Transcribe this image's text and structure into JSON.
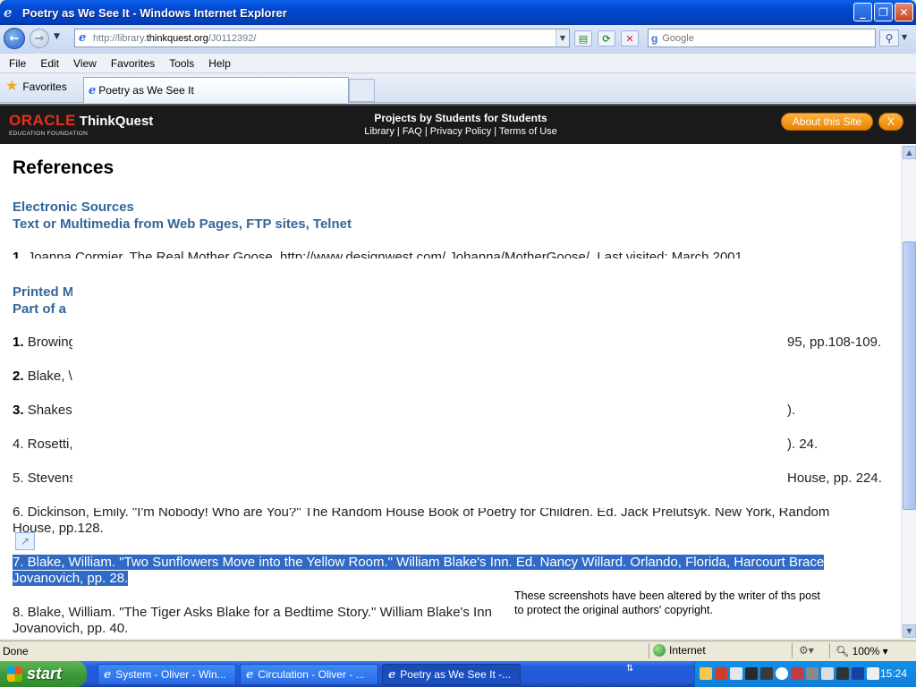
{
  "window": {
    "title": "Poetry as We See It - Windows Internet Explorer",
    "min_label": "_",
    "max_label": "❐",
    "close_label": "✕"
  },
  "address": {
    "url_prefix": "http://library.",
    "url_domain": "thinkquest.org",
    "url_suffix": "/J0112392/",
    "search_placeholder": "Google"
  },
  "menu": [
    "File",
    "Edit",
    "View",
    "Favorites",
    "Tools",
    "Help"
  ],
  "favbar": {
    "favorites_label": "Favorites",
    "tab_label": "Poetry as We See It"
  },
  "site_header": {
    "logo_oracle": "ORACLE",
    "logo_thinkquest": "ThinkQuest",
    "logo_sub": "EDUCATION FOUNDATION",
    "tagline": "Projects by Students for Students",
    "links": "Library | FAQ | Privacy Policy | Terms of Use",
    "about_button": "About this Site",
    "close_button": "X"
  },
  "page": {
    "title": "References",
    "section1_line1": "Electronic Sources",
    "section1_line2": "Text or Multimedia from Web Pages, FTP sites, Telnet",
    "e1_num": "1.",
    "e1_text": "Joanna Cormier. The Real Mother Goose. http://www.designwest.com/ Johanna/MotherGoose/. Last visited: March 2001",
    "section2_line1": "Printed M",
    "section2_line2": "Part of a",
    "p1_num": "1.",
    "p1_left": "Browing",
    "p1_right": "95, pp.108-109.",
    "p2_num": "2.",
    "p2_left": "Blake, \\",
    "p3_num": "3.",
    "p3_left": "Shakes",
    "p3_right": ").",
    "p4_left": "4. Rosetti,",
    "p4_right": "). 24.",
    "p5_left": "5. Stevens",
    "p5_right": "House, pp. 224.",
    "p6_text": "6. Dickinson, Emily. \"I'm Nobody! Who are You?\" The Random House Book of Poetry for Children. Ed. Jack Prelutsyk. New York, Random House, pp.128.",
    "p7_text": "7. Blake, William. \"Two Sunflowers Move into the Yellow Room.\" William Blake's Inn. Ed. Nancy Willard. Orlando, Florida, Harcourt Brace Jovanovich, pp. 28.",
    "p8_line1": "8. Blake, William. \"The Tiger Asks Blake for a Bedtime Story.\" William Blake's Inn",
    "p8_line2": "Jovanovich, pp. 40.",
    "note_line1": "These screenshots have been altered by the writer of ths post",
    "note_line2": "to protect the original authors' copyright."
  },
  "status": {
    "text": "Done",
    "zone": "Internet",
    "zoom": "100%"
  },
  "taskbar": {
    "start": "start",
    "tasks": [
      "System - Oliver - Win...",
      "Circulation - Oliver - ...",
      "Poetry as We See It -..."
    ],
    "clock": "15:24"
  }
}
